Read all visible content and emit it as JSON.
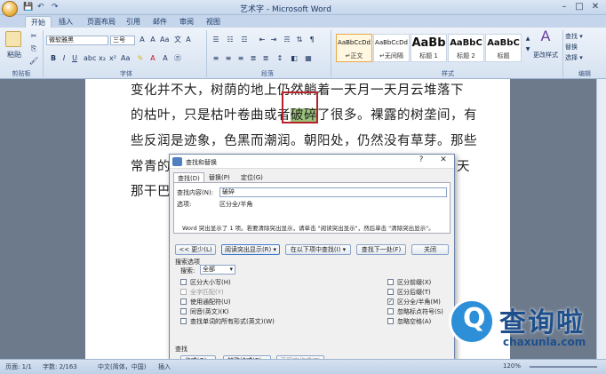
{
  "window": {
    "title": "艺术字 - Microsoft Word",
    "quick_access": [
      "💾",
      "↶",
      "↷"
    ],
    "controls": [
      "–",
      "□",
      "✕"
    ]
  },
  "ribbon": {
    "tabs": [
      "开始",
      "插入",
      "页面布局",
      "引用",
      "邮件",
      "审阅",
      "视图"
    ],
    "clipboard": {
      "paste": "粘贴",
      "group": "剪贴板"
    },
    "font": {
      "family": "微软雅黑",
      "size": "三号",
      "group": "字体"
    },
    "paragraph": {
      "group": "段落"
    },
    "styles": {
      "group": "样式",
      "items": [
        {
          "sample": "AaBbCcDd",
          "name": "↵正文"
        },
        {
          "sample": "AaBbCcDd",
          "name": "↵无间隔"
        },
        {
          "sample": "AaBb",
          "name": "标题 1"
        },
        {
          "sample": "AaBbC",
          "name": "标题 2"
        },
        {
          "sample": "AaBbC",
          "name": "标题"
        }
      ],
      "change_styles": "更改样式"
    },
    "editing": {
      "find": "查找 ▾",
      "replace": "替换",
      "select": "选择 ▾",
      "group": "编辑"
    }
  },
  "document": {
    "lines": [
      {
        "before": "变化并不大，树荫的地上仍然躺着一天月一天月云堆落下",
        "hl": "",
        "after": ""
      },
      {
        "before": "的枯叶，只是枯叶卷曲或者",
        "hl": "破碎",
        "after": "了很多。裸露的树垄间，有"
      },
      {
        "before": "些反润是迹象，色黑而潮润。朝阳处，仍然没有草芽。那些",
        "hl": "",
        "after": ""
      },
      {
        "before": "常青的",
        "hl": "",
        "after": "天"
      },
      {
        "before": "那干巴",
        "hl": "",
        "after": ""
      }
    ]
  },
  "dialog": {
    "title": "查找和替换",
    "help": "?",
    "close": "✕",
    "tabs": [
      "查找(D)",
      "替换(P)",
      "定位(G)"
    ],
    "find_label": "查找内容(N):",
    "find_value": "破碎",
    "options_label": "选项:",
    "options_value": "区分全/半角",
    "info": "Word 突出显示了 1 项。若要清除突出显示，请单击 \"阅读突出显示\"，然后单击 \"清除突出显示\"。",
    "buttons": {
      "less": "<< 更少(L)",
      "reading_highlight": "阅读突出显示(R) ▾",
      "find_in": "在以下项中查找(I) ▾",
      "find_next": "查找下一处(F)",
      "close": "关闭"
    },
    "search_options_label": "搜索选项",
    "search_label": "搜索:",
    "search_value": "全部",
    "left_checks": [
      {
        "label": "区分大小写(H)",
        "checked": false,
        "disabled": false
      },
      {
        "label": "全字匹配(Y)",
        "checked": false,
        "disabled": true
      },
      {
        "label": "使用通配符(U)",
        "checked": false,
        "disabled": false
      },
      {
        "label": "同音(英文)(K)",
        "checked": false,
        "disabled": false
      },
      {
        "label": "查找单词的所有形式(英文)(W)",
        "checked": false,
        "disabled": false
      }
    ],
    "right_checks": [
      {
        "label": "区分前缀(X)",
        "checked": false,
        "disabled": false
      },
      {
        "label": "区分后缀(T)",
        "checked": false,
        "disabled": false
      },
      {
        "label": "区分全/半角(M)",
        "checked": true,
        "disabled": false
      },
      {
        "label": "忽略标点符号(S)",
        "checked": false,
        "disabled": false
      },
      {
        "label": "忽略空格(A)",
        "checked": false,
        "disabled": false
      }
    ],
    "find_section_label": "查找",
    "format_btn": "格式(O) ▾",
    "special_btn": "特殊格式(E) ▾",
    "no_format_btn": "不限定格式(T)"
  },
  "status": {
    "page": "页面: 1/1",
    "words": "字数: 2/163",
    "lang": "中文(简体，中国)",
    "mode": "插入",
    "zoom": "120%"
  },
  "watermark": {
    "text": "查询啦",
    "url": "chaxunla.com"
  }
}
